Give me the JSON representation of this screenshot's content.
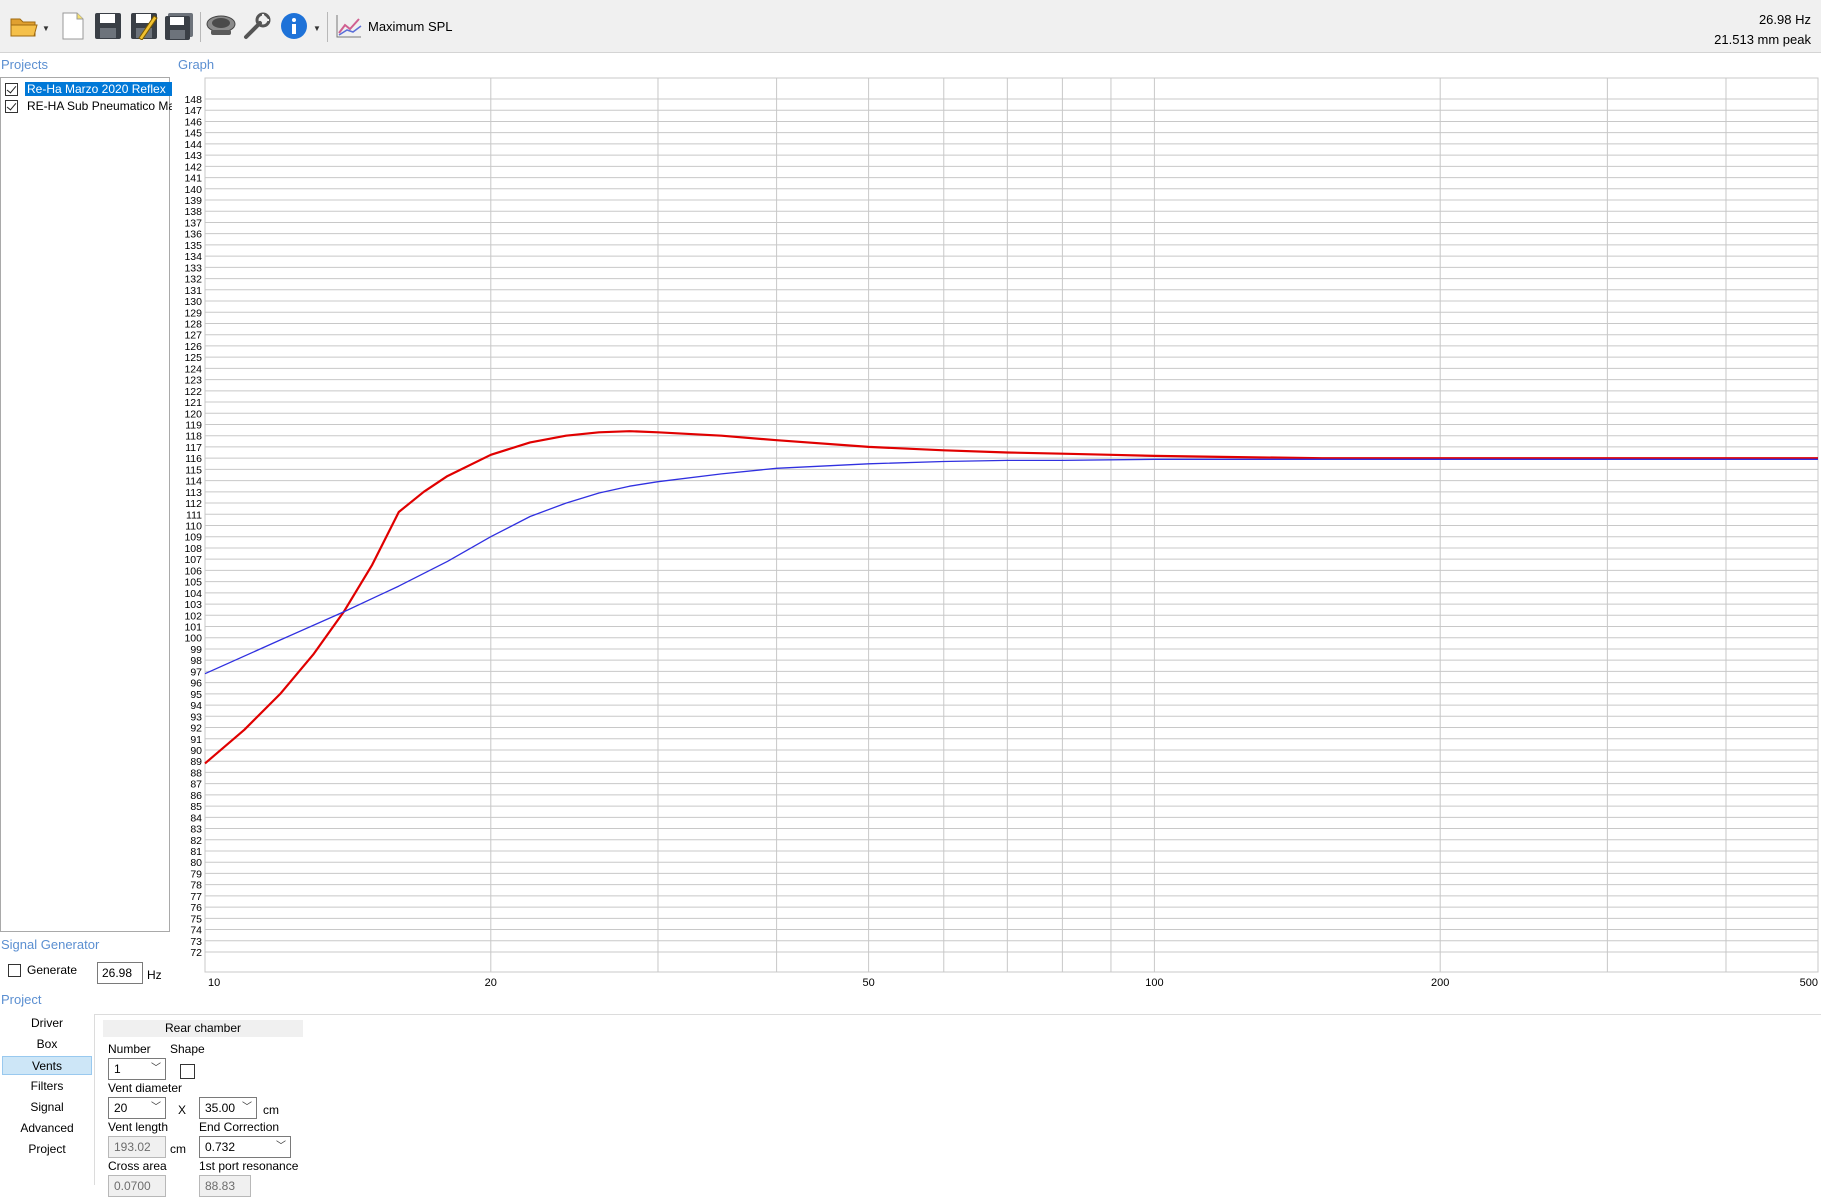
{
  "toolbar": {
    "mode_label": "Maximum SPL",
    "buttons": [
      "open-icon",
      "new-icon",
      "save-icon",
      "save-as-icon",
      "save-all-icon",
      "driver-icon",
      "tools-icon",
      "info-icon",
      "graph-mode-icon"
    ]
  },
  "readout": {
    "frequency": "26.98 Hz",
    "excursion": "21.513 mm peak"
  },
  "projects": {
    "title": "Projects",
    "items": [
      {
        "label": "Re-Ha Marzo 2020 Reflex",
        "checked": true,
        "selected": true
      },
      {
        "label": "RE-HA Sub Pneumatico Ma",
        "checked": true,
        "selected": false
      }
    ]
  },
  "graph": {
    "title": "Graph"
  },
  "signal_generator": {
    "title": "Signal Generator",
    "generate_label": "Generate",
    "frequency": "26.98",
    "unit": "Hz"
  },
  "project_panel": {
    "title": "Project",
    "tabs": [
      "Driver",
      "Box",
      "Vents",
      "Filters",
      "Signal",
      "Advanced",
      "Project"
    ],
    "active_tab": "Vents",
    "sub_header": "Rear chamber",
    "number_label": "Number",
    "number_value": "1",
    "shape_label": "Shape",
    "vent_diameter_label": "Vent diameter",
    "vent_diameter_value": "20",
    "x_label": "X",
    "vent_diameter2_value": "35.00",
    "cm_label": "cm",
    "vent_length_label": "Vent length",
    "vent_length_value": "193.02",
    "end_correction_label": "End Correction",
    "end_correction_value": "0.732",
    "cross_area_label": "Cross area",
    "cross_area_value": "0.0700",
    "port_resonance_label": "1st port resonance",
    "port_resonance_value": "88.83"
  },
  "chart_data": {
    "type": "line",
    "xscale": "log",
    "xlim": [
      10,
      500
    ],
    "ylim": [
      72,
      148
    ],
    "x_tick_labels": [
      "10",
      "20",
      "50",
      "100",
      "200",
      "500"
    ],
    "x_ticks": [
      10,
      20,
      50,
      100,
      200,
      500
    ],
    "x_gridlines": [
      10,
      20,
      30,
      40,
      50,
      60,
      70,
      80,
      90,
      100,
      200,
      300,
      400,
      500
    ],
    "y_tick_step": 1,
    "grid": true,
    "series": [
      {
        "color": "#e00000",
        "x": [
          10,
          11,
          12,
          13,
          14,
          15,
          16,
          17,
          18,
          20,
          22,
          24,
          26,
          28,
          30,
          35,
          40,
          50,
          60,
          70,
          80,
          90,
          100,
          120,
          150,
          200,
          250,
          300,
          400,
          500
        ],
        "y": [
          88.8,
          91.8,
          95.0,
          98.5,
          102.3,
          106.5,
          111.2,
          113.0,
          114.4,
          116.3,
          117.4,
          118.0,
          118.3,
          118.4,
          118.3,
          118.0,
          117.6,
          117.0,
          116.7,
          116.5,
          116.4,
          116.3,
          116.2,
          116.1,
          116.0,
          116.0,
          116.0,
          116.0,
          116.0,
          116.0
        ]
      },
      {
        "color": "#3030e0",
        "x": [
          10,
          12,
          14,
          16,
          18,
          20,
          22,
          24,
          26,
          28,
          30,
          35,
          40,
          50,
          60,
          70,
          80,
          100,
          150,
          200,
          300,
          500
        ],
        "y": [
          96.8,
          99.8,
          102.3,
          104.6,
          106.8,
          109.0,
          110.8,
          112.0,
          112.9,
          113.5,
          113.9,
          114.6,
          115.1,
          115.5,
          115.7,
          115.8,
          115.8,
          115.9,
          115.9,
          115.9,
          115.9,
          115.9
        ]
      }
    ]
  }
}
